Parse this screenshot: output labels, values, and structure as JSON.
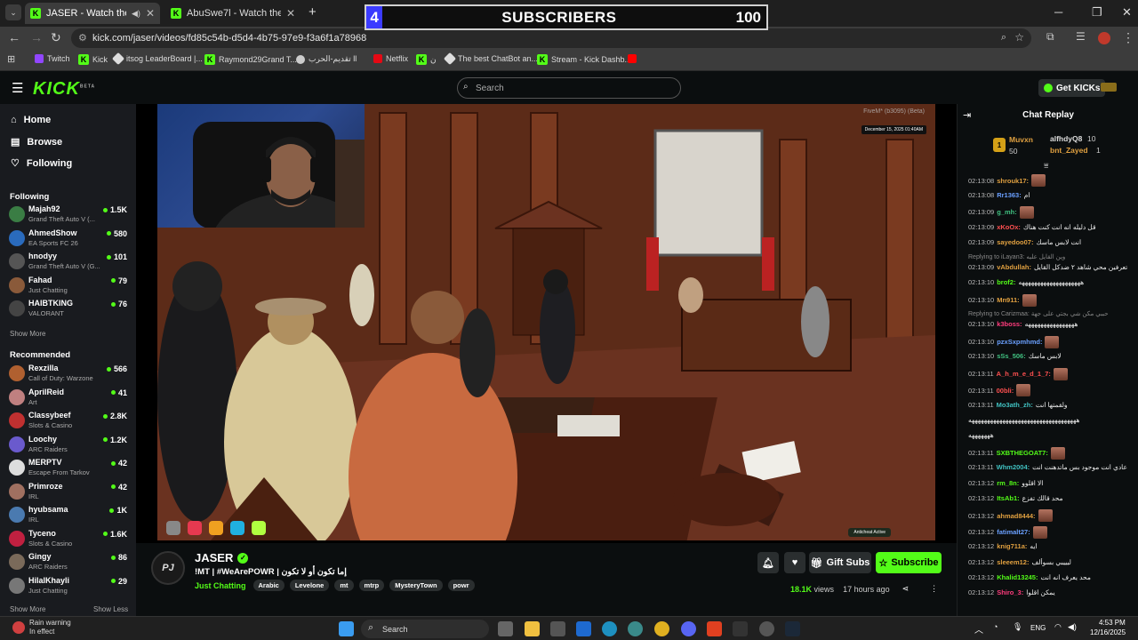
{
  "browser": {
    "tabs": [
      {
        "title": "JASER - Watch the VOD on",
        "active": true
      },
      {
        "title": "AbuSwe7l - Watch the VOD on",
        "active": false
      }
    ],
    "new_tab_label": "+",
    "url": "kick.com/jaser/videos/fd85c54b-d5d4-4b75-97e9-f3a6f1a78968",
    "bookmarks": [
      "Twitch",
      "Kick",
      "itsog LeaderBoard |...",
      "Raymond29Grand T...",
      "تقديم-الحرب ll",
      "Netflix",
      "ن",
      "The best ChatBot an...",
      "Stream - Kick Dashb..."
    ]
  },
  "sub_goal": {
    "current": "4",
    "label": "SUBSCRIBERS",
    "target": "100",
    "progress": 0.04
  },
  "header": {
    "logo": "KICK",
    "logo_badge": "BETA",
    "search_placeholder": "Search",
    "get_kicks": "Get KICKs"
  },
  "sidebar": {
    "nav": [
      {
        "label": "Home"
      },
      {
        "label": "Browse"
      },
      {
        "label": "Following"
      }
    ],
    "following_title": "Following",
    "following": [
      {
        "name": "Majah92",
        "category": "Grand Theft Auto V (...",
        "viewers": "1.5K",
        "color": "#3a7d44"
      },
      {
        "name": "AhmedShow",
        "category": "EA Sports FC 26",
        "viewers": "580",
        "color": "#2a6bbd"
      },
      {
        "name": "hnodyy",
        "category": "Grand Theft Auto V (G...",
        "viewers": "101",
        "color": "#555"
      },
      {
        "name": "Fahad",
        "category": "Just Chatting",
        "viewers": "79",
        "color": "#8a5a3a"
      },
      {
        "name": "HAIBTKING",
        "category": "VALORANT",
        "viewers": "76",
        "color": "#444"
      }
    ],
    "show_more": "Show More",
    "recommended_title": "Recommended",
    "recommended": [
      {
        "name": "Rexzilla",
        "category": "Call of Duty: Warzone",
        "viewers": "566",
        "color": "#b06030"
      },
      {
        "name": "AprilReid",
        "category": "Art",
        "viewers": "41",
        "color": "#c08080"
      },
      {
        "name": "Classybeef",
        "category": "Slots & Casino",
        "viewers": "2.8K",
        "color": "#c03030"
      },
      {
        "name": "Loochy",
        "category": "ARC Raiders",
        "viewers": "1.2K",
        "color": "#6a5acd"
      },
      {
        "name": "MERPTV",
        "category": "Escape From Tarkov",
        "viewers": "42",
        "color": "#dddddd"
      },
      {
        "name": "Primroze",
        "category": "IRL",
        "viewers": "42",
        "color": "#a07060"
      },
      {
        "name": "hyubsama",
        "category": "IRL",
        "viewers": "1K",
        "color": "#4a7ab0"
      },
      {
        "name": "Tyceno",
        "category": "Slots & Casino",
        "viewers": "1.6K",
        "color": "#c02040"
      },
      {
        "name": "Gingy",
        "category": "ARC Raiders",
        "viewers": "86",
        "color": "#7a6a5a"
      },
      {
        "name": "HilalKhayli",
        "category": "Just Chatting",
        "viewers": "29",
        "color": "#777"
      }
    ],
    "show_more_bottom": "Show More",
    "show_less": "Show Less"
  },
  "video": {
    "overlay_watermark": "FiveM* (b3095) (Beta)",
    "overlay_date": "December 15, 2025 01:40AM",
    "anticheat": "Anticheat Active"
  },
  "channel": {
    "name": "JASER",
    "title": "!MT | #WeArePOWR | إما تكون أو لا تكون",
    "category": "Just Chatting",
    "tags": [
      "Arabic",
      "Levelone",
      "mt",
      "mtrp",
      "MysteryTown",
      "powr"
    ],
    "views": "18.1K",
    "views_label": "views",
    "age": "17 hours ago",
    "gift_subs": "Gift Subs",
    "subscribe": "Subscribe"
  },
  "chat": {
    "title": "Chat Replay",
    "leaderboard": [
      {
        "name": "Muvxn",
        "count": "50",
        "rank": "1"
      },
      {
        "name": "alfhdyQ8",
        "count": "10"
      },
      {
        "name": "bnt_Zayed",
        "count": "1"
      }
    ],
    "messages": [
      {
        "ts": "02:13:08",
        "user": "shrouk17:",
        "color": "#e0a040",
        "text": "",
        "emote": true
      },
      {
        "ts": "02:13:08",
        "user": "Rr1363:",
        "color": "#6aa0ff",
        "text": "ام",
        "emote": false
      },
      {
        "ts": "02:13:09",
        "user": "g_mh:",
        "color": "#40c080",
        "text": "",
        "emote": true
      },
      {
        "ts": "02:13:09",
        "user": "xKoOx:",
        "color": "#ff5050",
        "text": "قل دليله انه انت كنت هناك",
        "emote": false
      },
      {
        "ts": "02:13:09",
        "user": "sayedoo07:",
        "color": "#e0a040",
        "text": "انت لابس ماسك",
        "emote": false
      },
      {
        "ts": "02:13:09",
        "user": "vAbdullah:",
        "color": "#e0a040",
        "text": "تعرفين محي شاهد ٢ ضدكل القايل",
        "emote": false,
        "reply": "Replying to iLayan3: وين القايل عليه"
      },
      {
        "ts": "02:13:10",
        "user": "brof2:",
        "color": "#53fc18",
        "text": "ههههههههههههههههههههه",
        "emote": false
      },
      {
        "ts": "02:13:10",
        "user": "Mn911:",
        "color": "#e0a040",
        "text": "",
        "emote": true
      },
      {
        "ts": "02:13:10",
        "user": "k3boss:",
        "color": "#ff3c7d",
        "text": "ههههههههههههههههه",
        "emote": false,
        "reply": "Replying to Carizmaa: حببي مكن شي بجتي على جهة"
      },
      {
        "ts": "02:13:10",
        "user": "pzxSxpmhmd:",
        "color": "#6aa0ff",
        "text": "",
        "emote": true
      },
      {
        "ts": "02:13:10",
        "user": "sSs_506:",
        "color": "#40c080",
        "text": "لابس ماسك",
        "emote": false
      },
      {
        "ts": "02:13:11",
        "user": "A_h_m_e_d_1_7:",
        "color": "#ff5050",
        "text": "",
        "emote": true
      },
      {
        "ts": "02:13:11",
        "user": "00bli:",
        "color": "#ff5050",
        "text": "",
        "emote": true
      },
      {
        "ts": "02:13:11",
        "user": "Mo3ath_zh:",
        "color": "#40c0c0",
        "text": "ولقمتها انت",
        "emote": false
      },
      {
        "ts": "",
        "user": "",
        "color": "#fff",
        "text": "هههههههههههههههههههههههههههههههههههه",
        "emote": false
      },
      {
        "ts": "",
        "user": "",
        "color": "#fff",
        "text": "هههههههه",
        "emote": false
      },
      {
        "ts": "02:13:11",
        "user": "SXBTHEGOAT7:",
        "color": "#53fc18",
        "text": "",
        "emote": true
      },
      {
        "ts": "02:13:11",
        "user": "Whm2004:",
        "color": "#40c0c0",
        "text": "عادي انت موجود بس ماتدهنت انت",
        "emote": false
      },
      {
        "ts": "02:13:12",
        "user": "rm_8n:",
        "color": "#53fc18",
        "text": "الا اقلوو",
        "emote": false
      },
      {
        "ts": "02:13:12",
        "user": "ItsAb1:",
        "color": "#53fc18",
        "text": "محد قالك تفزع",
        "emote": false
      },
      {
        "ts": "02:13:12",
        "user": "ahmad8444:",
        "color": "#e0a040",
        "text": "",
        "emote": true
      },
      {
        "ts": "02:13:12",
        "user": "fatimalt27:",
        "color": "#6aa0ff",
        "text": "",
        "emote": true
      },
      {
        "ts": "02:13:12",
        "user": "knig711a:",
        "color": "#e0a040",
        "text": "ايه",
        "emote": false
      },
      {
        "ts": "02:13:12",
        "user": "sleeem12:",
        "color": "#e0a040",
        "text": "ليييبي بسوألف",
        "emote": false
      },
      {
        "ts": "02:13:12",
        "user": "Khalid13245:",
        "color": "#53fc18",
        "text": "محد يعرف انه انت",
        "emote": false
      },
      {
        "ts": "02:13:12",
        "user": "Shiro_3:",
        "color": "#ff3c7d",
        "text": "يمكن اقلوا",
        "emote": false
      }
    ]
  },
  "taskbar": {
    "weather_title": "Rain warning",
    "weather_sub": "In effect",
    "search": "Search",
    "lang": "ENG",
    "time": "4:53 PM",
    "date": "12/16/2025"
  }
}
